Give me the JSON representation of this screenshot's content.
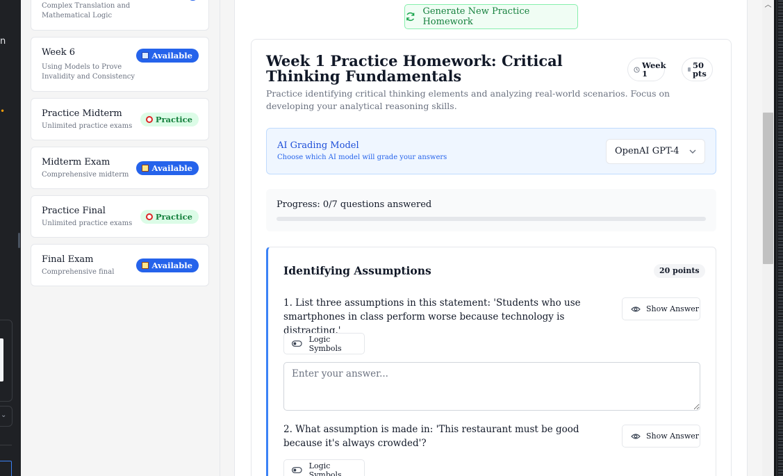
{
  "sidebar": {
    "weeks": [
      {
        "title": "",
        "subtitle": "Complex Translation and Mathematical Logic",
        "badge": "",
        "badge_type": "available",
        "badge_icon": "book-icon"
      },
      {
        "title": "Week 6",
        "subtitle": "Using Models to Prove Invalidity and Consistency",
        "badge": "Available",
        "badge_type": "available",
        "badge_icon": "book-icon"
      },
      {
        "title": "Practice Midterm",
        "subtitle": "Unlimited practice exams",
        "badge": "Practice",
        "badge_type": "practice",
        "badge_icon": "target-icon"
      },
      {
        "title": "Midterm Exam",
        "subtitle": "Comprehensive midterm",
        "badge": "Available",
        "badge_type": "available",
        "badge_icon": "document-icon"
      },
      {
        "title": "Practice Final",
        "subtitle": "Unlimited practice exams",
        "badge": "Practice",
        "badge_type": "practice",
        "badge_icon": "target-icon"
      },
      {
        "title": "Final Exam",
        "subtitle": "Comprehensive final",
        "badge": "Available",
        "badge_type": "available",
        "badge_icon": "document-icon"
      }
    ]
  },
  "main": {
    "generate_button": "Generate New Practice Homework",
    "homework": {
      "title": "Week 1 Practice Homework: Critical Thinking Fundamentals",
      "description": "Practice identifying critical thinking elements and analyzing real-world scenarios. Focus on developing your analytical reasoning skills.",
      "week_pill": "Week 1",
      "points_pill": "50 pts"
    },
    "grading": {
      "title": "AI Grading Model",
      "subtitle": "Choose which AI model will grade your answers",
      "selected_model": "OpenAI GPT-4"
    },
    "progress": {
      "text": "Progress: 0/7 questions answered",
      "answered": 0,
      "total": 7
    },
    "section": {
      "title": "Identifying Assumptions",
      "points": "20 points",
      "questions": [
        {
          "text": "1. List three assumptions in this statement: 'Students who use smartphones in class perform worse because technology is distracting.'",
          "show_answer": "Show Answer",
          "logic_symbols": "Logic Symbols",
          "placeholder": "Enter your answer..."
        },
        {
          "text": "2. What assumption is made in: 'This restaurant must be good because it's always crowded'?",
          "show_answer": "Show Answer",
          "logic_symbols": "Logic Symbols"
        }
      ]
    }
  },
  "colors": {
    "accent": "#2563eb",
    "practice_bg": "#dcfce7",
    "practice_text": "#15803d",
    "generate_border": "#86efac",
    "section_accent": "#3b82f6"
  }
}
